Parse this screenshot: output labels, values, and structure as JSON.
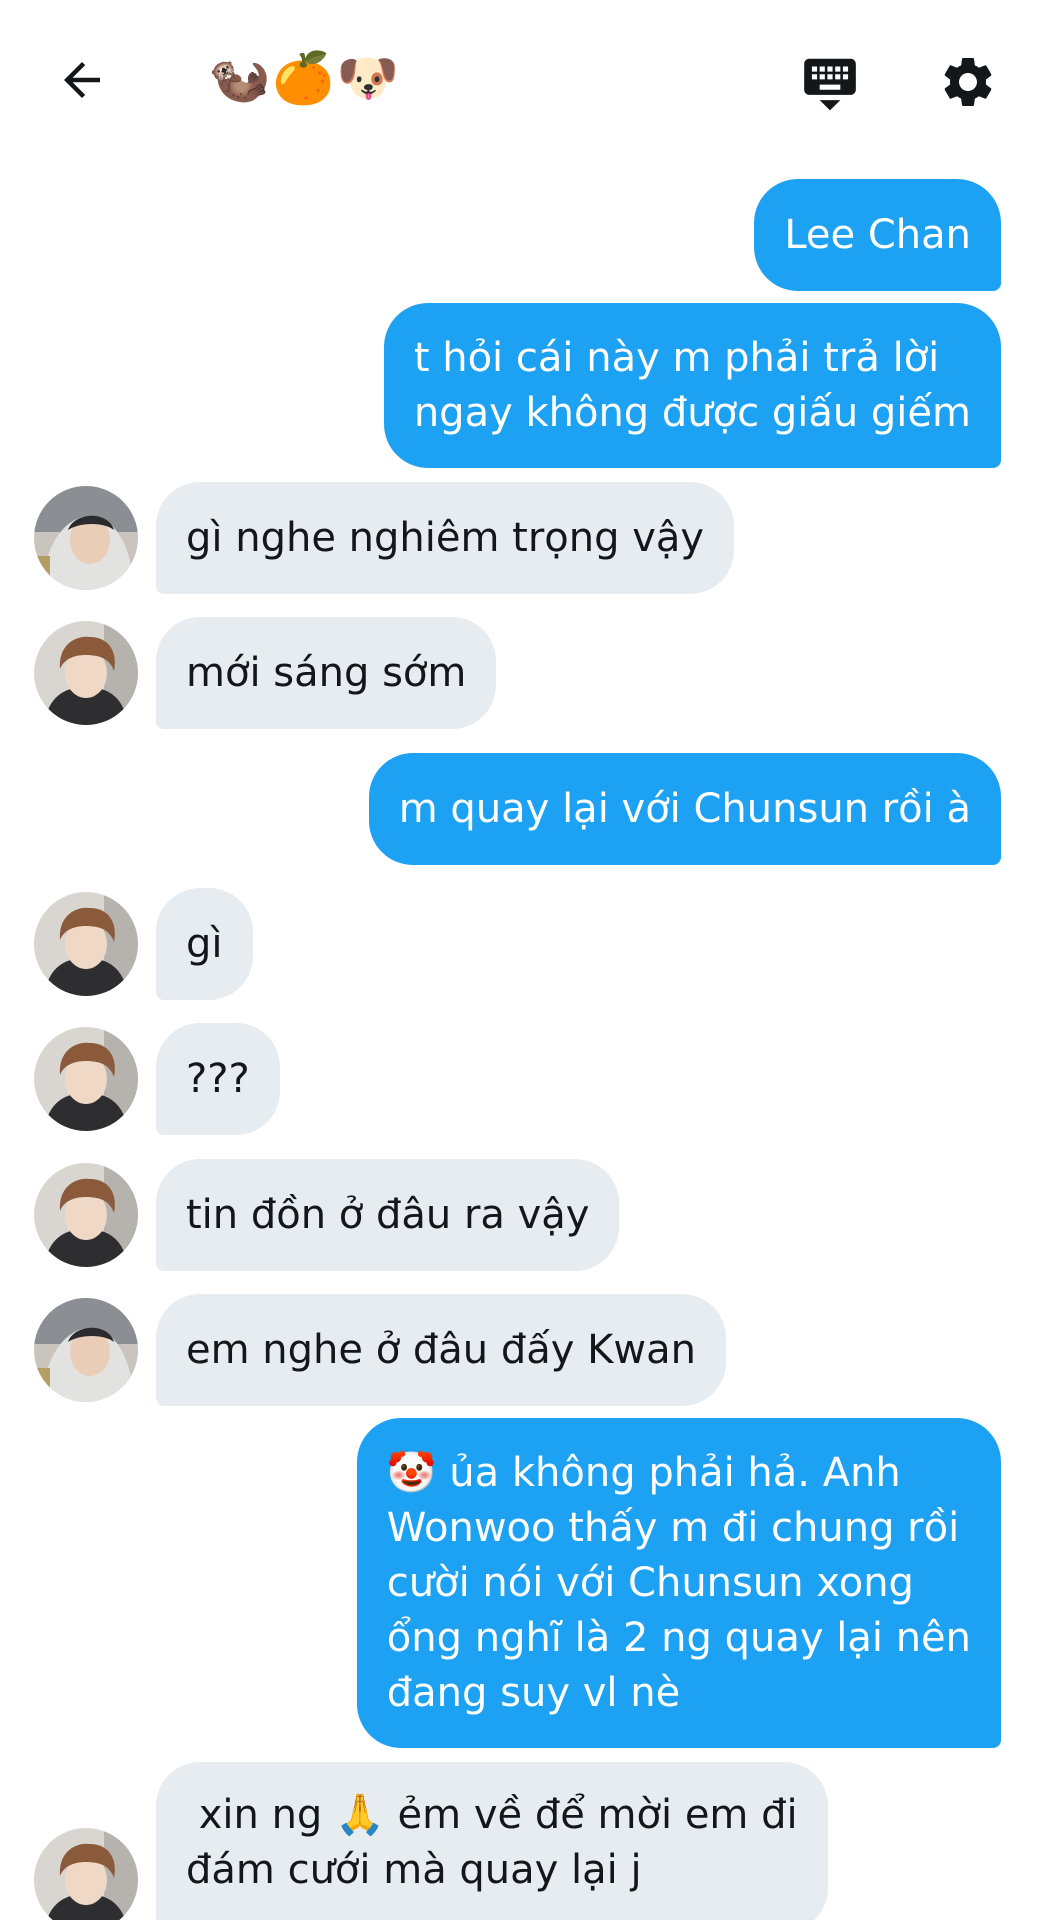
{
  "header": {
    "title": "🦦🍊🐶",
    "back_icon": "arrow-left-icon",
    "keyboard_icon": "keyboard-hide-icon",
    "settings_icon": "gear-icon"
  },
  "colors": {
    "outgoing_bubble": "#1da1f2",
    "incoming_bubble": "#e6ecf0",
    "background": "#ffffff"
  },
  "messages": [
    {
      "direction": "out",
      "text": "Lee Chan"
    },
    {
      "direction": "out",
      "text": "t hỏi cái này m phải trả lời\nngay không được giấu giếm"
    },
    {
      "direction": "in",
      "sender_avatar": "avatar-hood",
      "text": "gì nghe nghiêm trọng vậy"
    },
    {
      "direction": "in",
      "sender_avatar": "avatar-curly",
      "text": "mới sáng sớm"
    },
    {
      "direction": "out",
      "text": "m quay lại với Chunsun rồi à"
    },
    {
      "direction": "in",
      "sender_avatar": "avatar-curly",
      "text": "gì"
    },
    {
      "direction": "in",
      "sender_avatar": "avatar-curly",
      "text": "???"
    },
    {
      "direction": "in",
      "sender_avatar": "avatar-curly",
      "text": "tin đồn ở đâu ra vậy"
    },
    {
      "direction": "in",
      "sender_avatar": "avatar-hood",
      "text": "em nghe ở đâu đấy Kwan"
    },
    {
      "direction": "out",
      "text": "🤡 ủa không phải hả. Anh\nWonwoo thấy m đi chung rồi\ncười nói với Chunsun xong\nổng nghĩ là 2 ng quay lại nên\nđang suy vl nè"
    },
    {
      "direction": "in",
      "sender_avatar": "avatar-curly",
      "text": " xin ng 🙏 ẻm về để mời em đi\nđám cưới mà quay lại j"
    }
  ]
}
